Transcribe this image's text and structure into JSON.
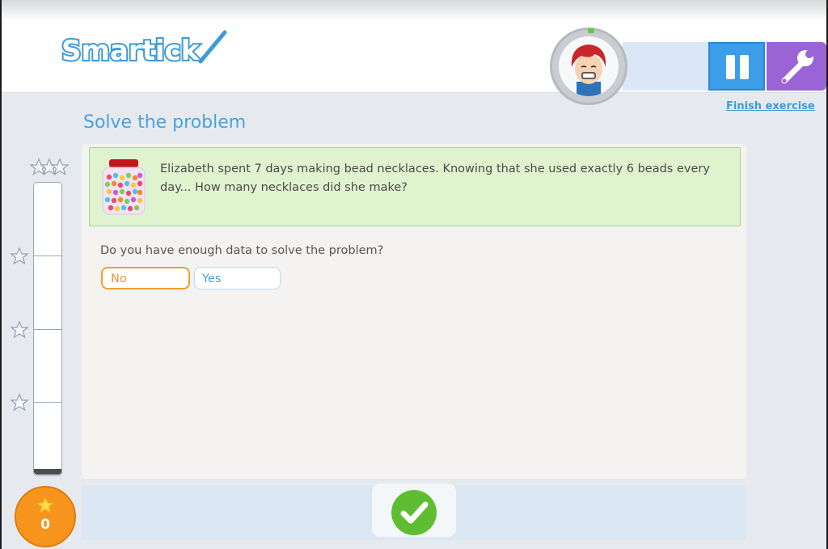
{
  "app": {
    "logo_text": "Smartick"
  },
  "header": {
    "finish_label": "Finish exercise",
    "pause_icon": "pause-icon",
    "tools_icon": "wrench-icon"
  },
  "exercise": {
    "title": "Solve the problem",
    "problem_text": "Elizabeth spent 7 days making bead necklaces. Knowing that she used exactly 6 beads every day... How many necklaces did she make?",
    "question": "Do you have enough data to solve the problem?",
    "options": [
      "No",
      "Yes"
    ],
    "selected_option": "No"
  },
  "progress": {
    "level": 0,
    "score": "0"
  },
  "colors": {
    "brand_blue": "#3c9ee8",
    "tools_purple": "#9a63d6",
    "problem_green": "#dff3cf",
    "selected_orange": "#f0a030",
    "score_orange": "#f7941d",
    "check_green": "#5fbd33"
  }
}
